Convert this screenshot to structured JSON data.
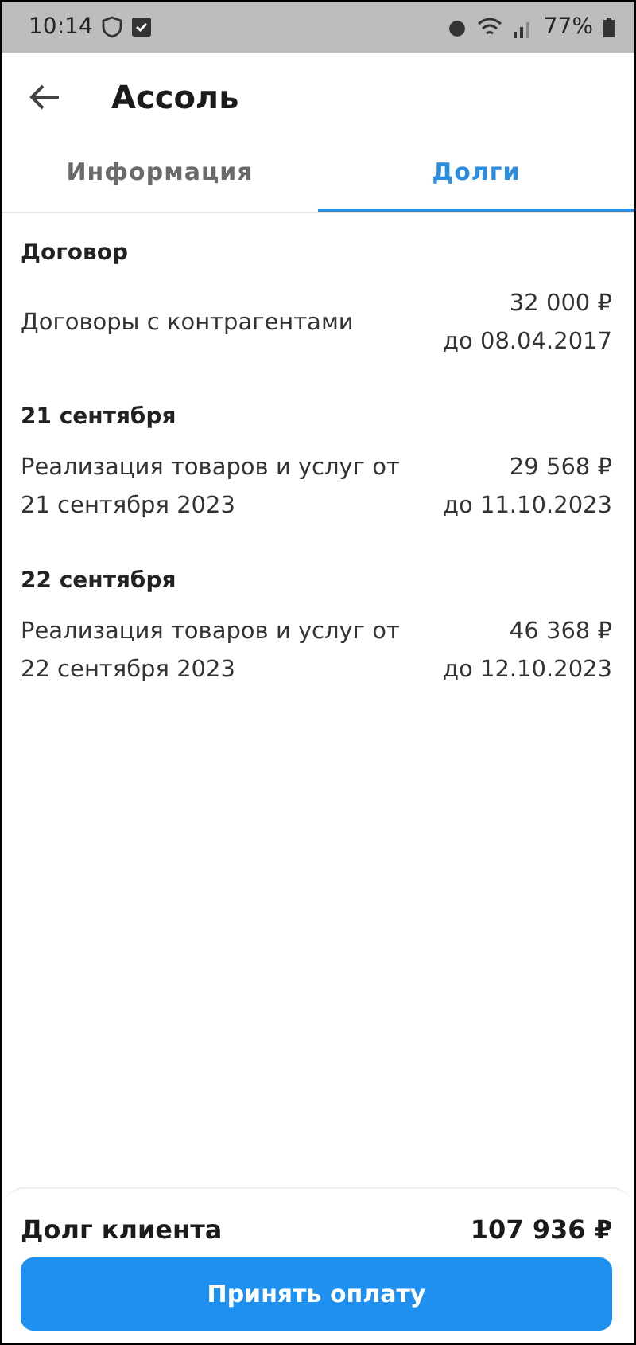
{
  "status_bar": {
    "time": "10:14",
    "battery": "77%"
  },
  "header": {
    "title": "Ассоль"
  },
  "tabs": [
    {
      "label": "Информация",
      "selected": false
    },
    {
      "label": "Долги",
      "selected": true
    }
  ],
  "groups": [
    {
      "title": "Договор",
      "items": [
        {
          "name": "Договоры с контрагентами",
          "amount": "32 000 ₽",
          "due": "до 08.04.2017"
        }
      ]
    },
    {
      "title": "21 сентября",
      "items": [
        {
          "name": "Реализация товаров и услуг от 21 сентября 2023",
          "amount": "29 568 ₽",
          "due": "до 11.10.2023"
        }
      ]
    },
    {
      "title": "22 сентября",
      "items": [
        {
          "name": "Реализация товаров и услуг от 22 сентября 2023",
          "amount": "46 368 ₽",
          "due": "до 12.10.2023"
        }
      ]
    }
  ],
  "footer": {
    "label": "Долг клиента",
    "total": "107 936 ₽",
    "button": "Принять оплату"
  }
}
